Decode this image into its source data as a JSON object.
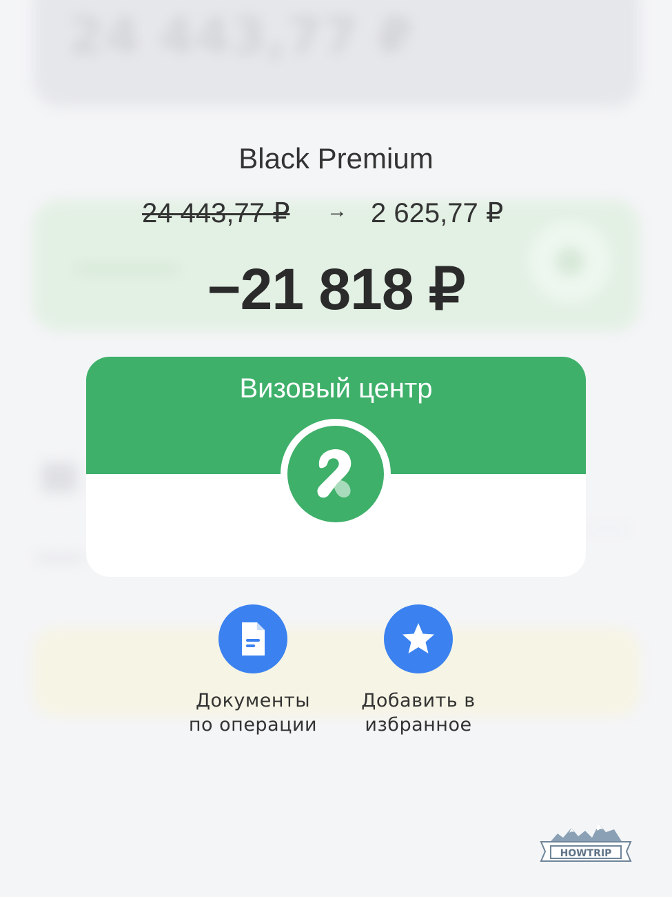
{
  "background": {
    "top_card_text": "24 443,77 ₽"
  },
  "transaction": {
    "product_name": "Black Premium",
    "balance_before": "24 443,77 ₽",
    "balance_arrow": "→",
    "balance_after": "2 625,77 ₽",
    "amount": "−21 818 ₽"
  },
  "merchant": {
    "name": "Визовый центр",
    "logo_icon": "merchant-logo-icon",
    "color": "#3eb06a"
  },
  "actions": [
    {
      "label": "Документы\nпо операции",
      "icon": "document-icon"
    },
    {
      "label": "Добавить в\nизбранное",
      "icon": "star-icon"
    }
  ],
  "colors": {
    "accent_green": "#3eb06a",
    "action_blue": "#3b82f0",
    "background": "#f4f5f7"
  },
  "watermark": {
    "text": "HOWTRIP"
  }
}
